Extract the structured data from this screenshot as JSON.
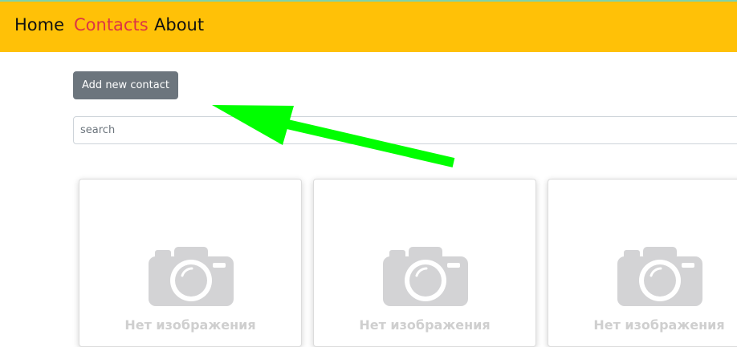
{
  "nav": {
    "items": [
      {
        "label": "Home",
        "active": false
      },
      {
        "label": "Contacts",
        "active": true
      },
      {
        "label": "About",
        "active": false
      }
    ],
    "background": "#ffc107",
    "active_color": "#dc3545"
  },
  "toolbar": {
    "add_label": "Add new contact",
    "button_color": "#6c757d"
  },
  "search": {
    "placeholder": "search",
    "value": ""
  },
  "annotation": {
    "arrow_color": "#00ff00",
    "icon": "arrow-icon"
  },
  "cards": [
    {
      "placeholder_text": "Нет изображения",
      "icon": "camera-icon"
    },
    {
      "placeholder_text": "Нет изображения",
      "icon": "camera-icon"
    },
    {
      "placeholder_text": "Нет изображения",
      "icon": "camera-icon"
    }
  ]
}
